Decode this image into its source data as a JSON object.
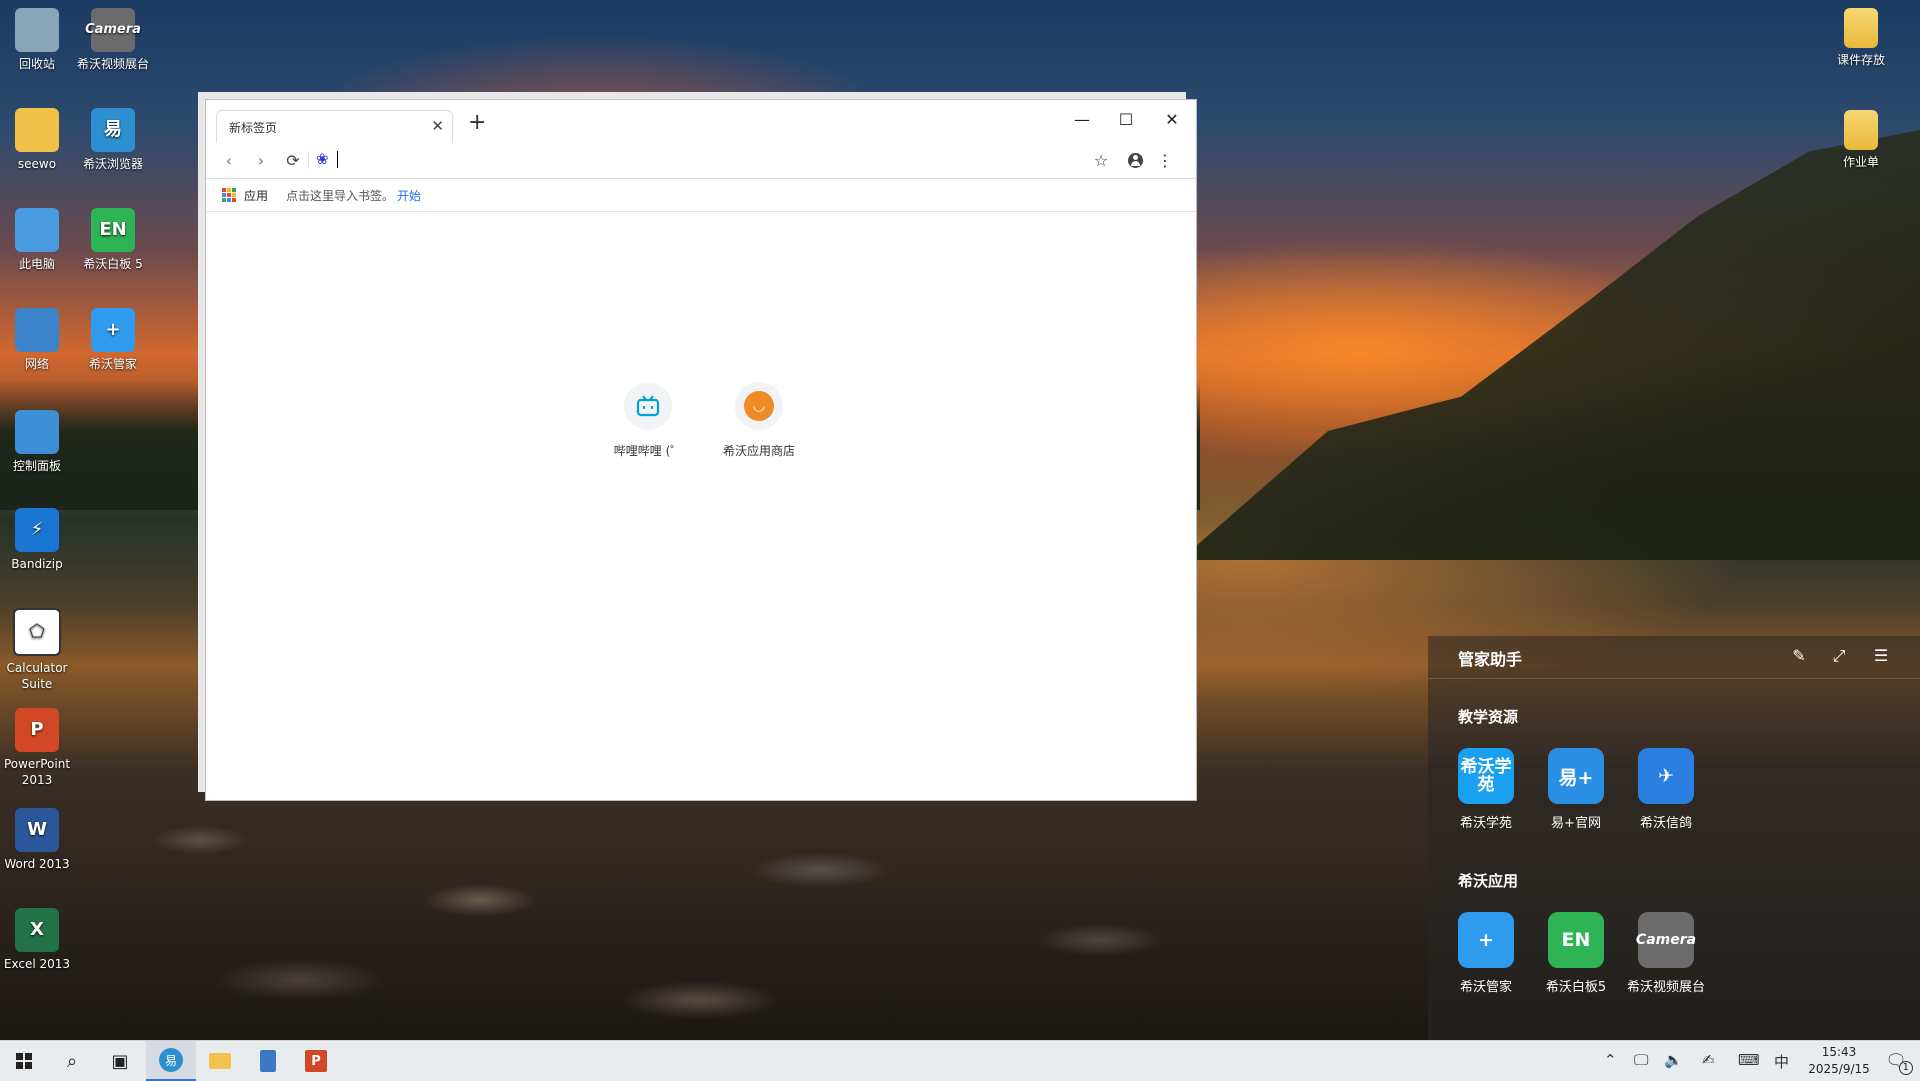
{
  "desktop": {
    "left_icons": [
      {
        "label": "回收站",
        "icon": "recycle-bin-icon",
        "color": "#8aa4b8"
      },
      {
        "label": "希沃视频展台",
        "icon": "camera-app-icon",
        "color": "#6b6b6b",
        "glyph": "Camera"
      },
      {
        "label": "seewo",
        "icon": "user-folder-icon",
        "color": "#f0c24a"
      },
      {
        "label": "希沃浏览器",
        "icon": "seewo-browser-icon",
        "color": "#2e8fd0",
        "glyph": "易"
      },
      {
        "label": "此电脑",
        "icon": "computer-icon",
        "color": "#4a9be0"
      },
      {
        "label": "希沃白板 5",
        "icon": "whiteboard-icon",
        "color": "#2fb455",
        "glyph": "EN"
      },
      {
        "label": "网络",
        "icon": "network-icon",
        "color": "#3b84c9"
      },
      {
        "label": "希沃管家",
        "icon": "shield-icon",
        "color": "#2e9bef",
        "glyph": "+"
      },
      {
        "label": "控制面板",
        "icon": "control-panel-icon",
        "color": "#3d8fd6"
      },
      {
        "label": "Bandizip",
        "icon": "bandizip-icon",
        "color": "#1976d2",
        "glyph": "⚡"
      },
      {
        "label": "Calculator Suite",
        "icon": "geogebra-icon",
        "color": "#ffffff"
      },
      {
        "label": "PowerPoint 2013",
        "icon": "powerpoint-icon",
        "color": "#d24726",
        "glyph": "P"
      },
      {
        "label": "Word 2013",
        "icon": "word-icon",
        "color": "#2b579a",
        "glyph": "W"
      },
      {
        "label": "Excel 2013",
        "icon": "excel-icon",
        "color": "#217346",
        "glyph": "X"
      }
    ],
    "right_icons": [
      {
        "label": "课件存放",
        "icon": "folder-icon"
      },
      {
        "label": "作业单",
        "icon": "folder-icon"
      }
    ]
  },
  "browser": {
    "tab_title": "新标签页",
    "tab_close": "✕",
    "new_tab": "+",
    "controls": {
      "minimize": "—",
      "maximize": "☐",
      "close": "✕"
    },
    "omnibox_value": "",
    "bookmarks": {
      "apps_label": "应用",
      "hint": "点击这里导入书签。",
      "link": "开始"
    },
    "shortcuts": [
      {
        "label": "哔哩哔哩 (゜",
        "icon": "bilibili-icon",
        "color": "#00a1d6"
      },
      {
        "label": "希沃应用商店",
        "icon": "app-store-icon",
        "color": "#f08a24"
      }
    ]
  },
  "panel": {
    "title": "管家助手",
    "sections": [
      {
        "title": "教学资源",
        "items": [
          {
            "label": "希沃学苑",
            "icon": "seewo-academy-icon",
            "color": "#1aa0f0",
            "glyph": "希沃学苑"
          },
          {
            "label": "易+官网",
            "icon": "yi-plus-icon",
            "color": "#2b8fe6",
            "glyph": "易+"
          },
          {
            "label": "希沃信鸽",
            "icon": "seewo-pigeon-icon",
            "color": "#2a7fe0",
            "glyph": "✈"
          }
        ]
      },
      {
        "title": "希沃应用",
        "items": [
          {
            "label": "希沃管家",
            "icon": "shield-icon",
            "color": "#2e9bef",
            "glyph": "+"
          },
          {
            "label": "希沃白板5",
            "icon": "whiteboard-icon",
            "color": "#2fb455",
            "glyph": "EN"
          },
          {
            "label": "希沃视频展台",
            "icon": "camera-app-icon",
            "color": "#6b6b6b",
            "glyph": "Camera"
          }
        ]
      }
    ]
  },
  "taskbar": {
    "ime": "中",
    "time": "15:43",
    "date": "2025/9/15",
    "notification_count": "1"
  }
}
